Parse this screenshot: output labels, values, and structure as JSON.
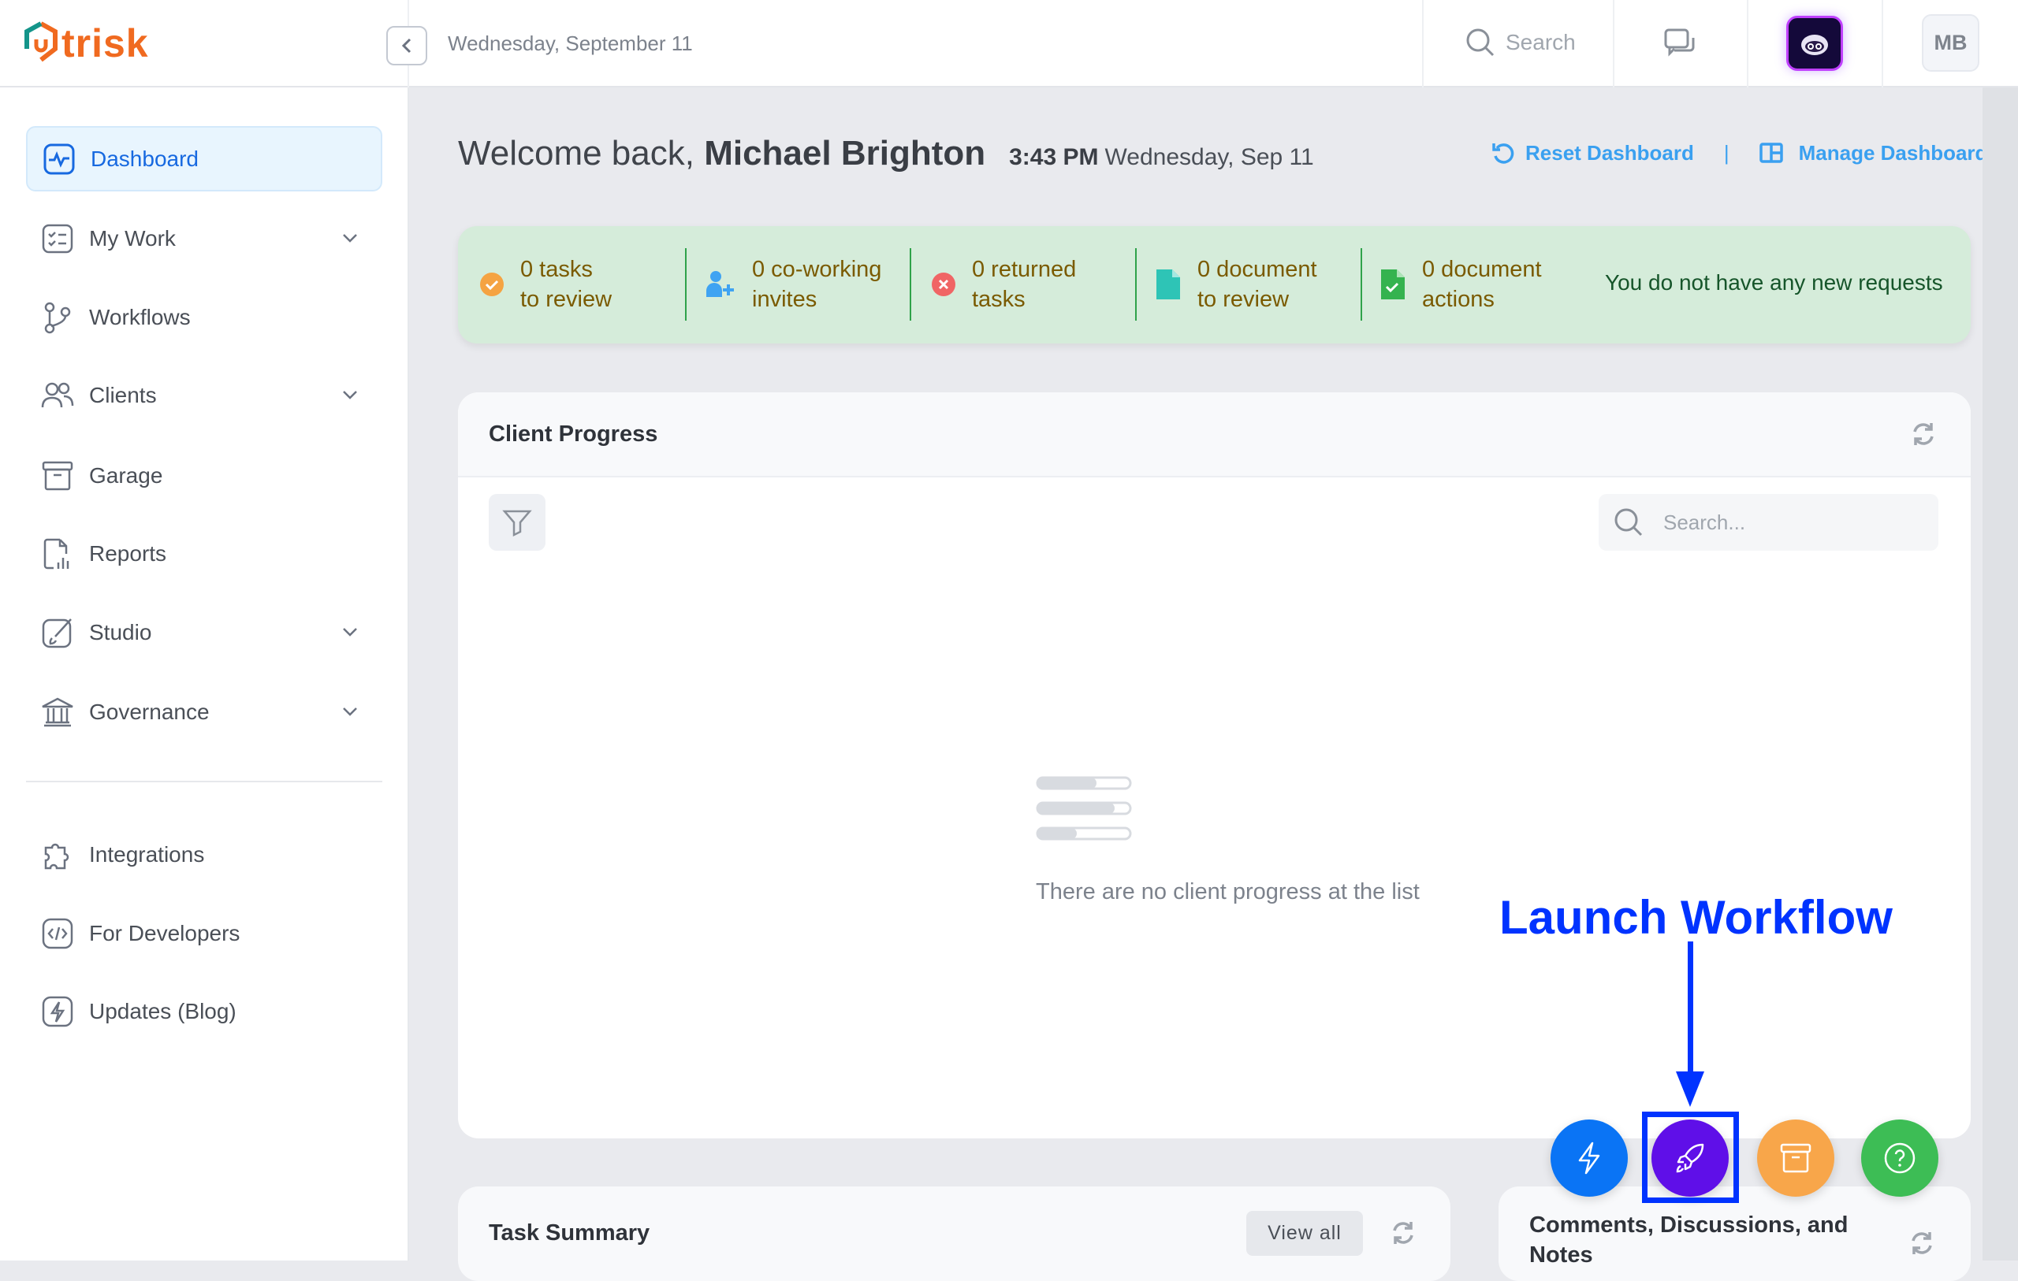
{
  "header": {
    "logo_text": "trisk",
    "date": "Wednesday, September 11",
    "search_label": "Search",
    "user_initials": "MB"
  },
  "sidebar": {
    "items": [
      {
        "label": "Dashboard",
        "icon": "dashboard-icon",
        "active": true
      },
      {
        "label": "My Work",
        "icon": "checklist-icon",
        "expandable": true
      },
      {
        "label": "Workflows",
        "icon": "workflow-icon"
      },
      {
        "label": "Clients",
        "icon": "users-icon",
        "expandable": true
      },
      {
        "label": "Garage",
        "icon": "archive-icon"
      },
      {
        "label": "Reports",
        "icon": "report-icon"
      },
      {
        "label": "Studio",
        "icon": "brush-icon",
        "expandable": true
      },
      {
        "label": "Governance",
        "icon": "bank-icon",
        "expandable": true
      }
    ],
    "bottom_items": [
      {
        "label": "Integrations",
        "icon": "puzzle-icon"
      },
      {
        "label": "For Developers",
        "icon": "code-icon"
      },
      {
        "label": "Updates (Blog)",
        "icon": "bolt-icon"
      }
    ]
  },
  "main": {
    "welcome_prefix": "Welcome back, ",
    "user_name": "Michael Brighton",
    "time": "3:43 PM",
    "date": "Wednesday, Sep 11",
    "reset_label": "Reset Dashboard",
    "manage_label": "Manage Dashboard",
    "separator": "|",
    "banner": {
      "items": [
        {
          "line1": "0 tasks",
          "line2": "to review",
          "icon": "check-circle-icon",
          "color": "#f5a342"
        },
        {
          "line1": "0 co-working",
          "line2": "invites",
          "icon": "user-plus-icon",
          "color": "#3fa3f2"
        },
        {
          "line1": "0 returned",
          "line2": "tasks",
          "icon": "x-circle-icon",
          "color": "#f06565"
        },
        {
          "line1": "0 document",
          "line2": "to review",
          "icon": "document-icon",
          "color": "#2ec4b6"
        },
        {
          "line1": "0 document",
          "line2": "actions",
          "icon": "document-check-icon",
          "color": "#35b34f"
        }
      ],
      "message": "You do not have any new requests"
    },
    "client_progress": {
      "title": "Client Progress",
      "search_placeholder": "Search...",
      "empty_text": "There are no client progress at the list"
    },
    "task_summary": {
      "title": "Task Summary",
      "view_all": "View all"
    },
    "comments": {
      "title": "Comments, Discussions, and Notes"
    }
  },
  "annotation": {
    "label": "Launch Workflow",
    "color": "#0033ff"
  },
  "fabs": [
    {
      "icon": "bolt-icon",
      "color": "#0a74f5"
    },
    {
      "icon": "rocket-icon",
      "color": "#5f0fe8"
    },
    {
      "icon": "archive-icon",
      "color": "#f8a64a"
    },
    {
      "icon": "help-icon",
      "color": "#3dbd55"
    }
  ]
}
